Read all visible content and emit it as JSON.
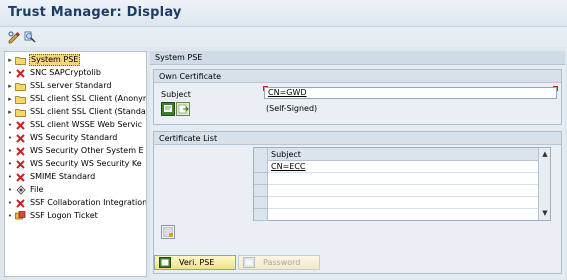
{
  "window": {
    "title": "Trust Manager: Display"
  },
  "toolbar": {
    "buttons": [
      {
        "icon": "display-change-icon"
      },
      {
        "icon": "other-object-icon"
      }
    ]
  },
  "tree": {
    "items": [
      {
        "label": "System PSE",
        "icon": "folder-icon",
        "selected": true
      },
      {
        "label": "SNC SAPCryptolib",
        "icon": "red-x-icon"
      },
      {
        "label": "SSL server Standard",
        "icon": "folder-icon"
      },
      {
        "label": "SSL client SSL Client (Anonym",
        "icon": "folder-icon"
      },
      {
        "label": "SSL client SSL Client (Standa",
        "icon": "folder-icon"
      },
      {
        "label": "SSL client WSSE Web Servic",
        "icon": "red-x-icon"
      },
      {
        "label": "WS Security Standard",
        "icon": "red-x-icon"
      },
      {
        "label": "WS Security Other System E",
        "icon": "red-x-icon"
      },
      {
        "label": "WS Security WS Security Ke",
        "icon": "red-x-icon"
      },
      {
        "label": "SMIME Standard",
        "icon": "red-x-icon"
      },
      {
        "label": "File",
        "icon": "file-icon"
      },
      {
        "label": "SSF Collaboration Integration",
        "icon": "red-x-icon"
      },
      {
        "label": "SSF Logon Ticket",
        "icon": "ticket-icon"
      }
    ]
  },
  "panel": {
    "header": "System PSE",
    "own_certificate": {
      "title": "Own Certificate",
      "subject_label": "Subject",
      "subject_value": "CN=GWD",
      "self_signed": "(Self-Signed)"
    },
    "certificate_list": {
      "title": "Certificate List",
      "column": "Subject",
      "rows": [
        "CN=ECC",
        "",
        "",
        "",
        ""
      ]
    }
  },
  "buttons": {
    "veri_pse": "Veri. PSE",
    "password": "Password"
  },
  "colors": {
    "title": "#1c3d66",
    "selected_bg": "#f3d67b",
    "error_red": "#cc2222",
    "button_yellow": "#f2e08c"
  }
}
